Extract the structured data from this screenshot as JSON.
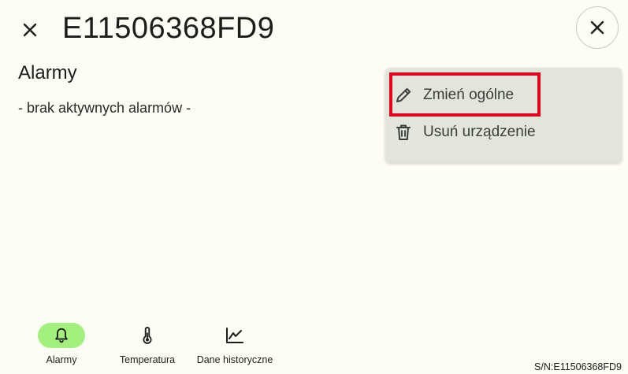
{
  "header": {
    "title": "E11506368FD9",
    "close_icon": "close-icon",
    "dismiss_icon": "close-icon"
  },
  "section": {
    "heading": "Alarmy",
    "empty_text": "- brak aktywnych alarmów -"
  },
  "menu": {
    "items": [
      {
        "label": "Zmień ogólne",
        "icon": "pencil-icon"
      },
      {
        "label": "Usuń urządzenie",
        "icon": "trash-icon"
      }
    ],
    "highlighted_item": "Zmień ogólne",
    "highlight_color": "#e3001b"
  },
  "nav": {
    "items": [
      {
        "label": "Alarmy",
        "icon": "bell-icon",
        "active": true
      },
      {
        "label": "Temperatura",
        "icon": "thermometer-icon",
        "active": false
      },
      {
        "label": "Dane historyczne",
        "icon": "line-chart-icon",
        "active": false
      }
    ],
    "active_color": "#a4f07f"
  },
  "footer": {
    "serial": "S/N:E11506368FD9"
  },
  "colors": {
    "background": "#fefdf5",
    "menu_background": "#e1e5dc"
  }
}
